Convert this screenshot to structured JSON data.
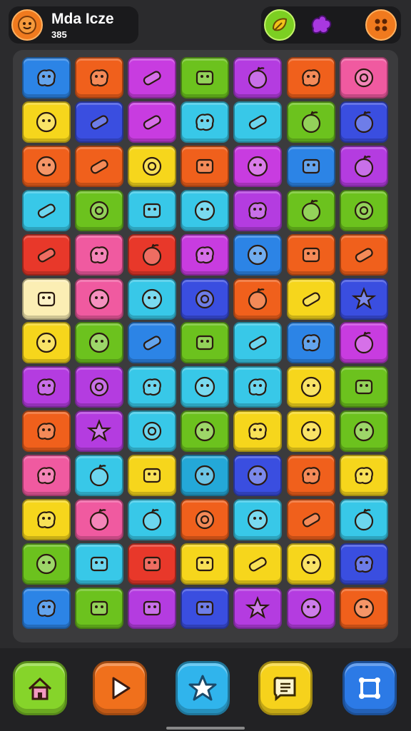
{
  "header": {
    "title": "Mda Icze",
    "score": "385"
  },
  "colors": {
    "blue": "#2c84e6",
    "orange": "#f0601c",
    "purple": "#b43ce0",
    "green": "#6cc21e",
    "cyan": "#38c8e8",
    "pink": "#f05aa0",
    "yellow": "#f6d61c",
    "red": "#e8382a",
    "magenta": "#c83ce0",
    "cream": "#fbeeb4",
    "teal": "#24a8d8",
    "indigo": "#3a4ee0"
  },
  "grid": [
    [
      "blue",
      "orange",
      "magenta",
      "green",
      "purple",
      "orange",
      "pink"
    ],
    [
      "yellow",
      "indigo",
      "magenta",
      "cyan",
      "cyan",
      "green",
      "indigo"
    ],
    [
      "orange",
      "orange",
      "yellow",
      "orange",
      "magenta",
      "blue",
      "purple"
    ],
    [
      "cyan",
      "green",
      "cyan",
      "cyan",
      "purple",
      "green",
      "green"
    ],
    [
      "red",
      "pink",
      "red",
      "magenta",
      "blue",
      "orange",
      "orange"
    ],
    [
      "cream",
      "pink",
      "cyan",
      "indigo",
      "orange",
      "yellow",
      "indigo"
    ],
    [
      "yellow",
      "green",
      "blue",
      "green",
      "cyan",
      "blue",
      "magenta"
    ],
    [
      "purple",
      "purple",
      "cyan",
      "cyan",
      "cyan",
      "yellow",
      "green"
    ],
    [
      "orange",
      "purple",
      "cyan",
      "green",
      "yellow",
      "yellow",
      "green"
    ],
    [
      "pink",
      "cyan",
      "yellow",
      "teal",
      "indigo",
      "orange",
      "yellow"
    ],
    [
      "yellow",
      "pink",
      "cyan",
      "orange",
      "cyan",
      "orange",
      "cyan"
    ],
    [
      "green",
      "cyan",
      "red",
      "yellow",
      "yellow",
      "yellow",
      "indigo"
    ],
    [
      "blue",
      "green",
      "purple",
      "indigo",
      "purple",
      "purple",
      "orange"
    ]
  ],
  "icons": [
    [
      "octopus-icon",
      "bug-icon",
      "candy-icon",
      "robot-icon",
      "apple-icon",
      "crab-icon",
      "donut-icon"
    ],
    [
      "smiley-icon",
      "potion-icon",
      "pencil-icon",
      "fish-icon",
      "carrot-icon",
      "orange-icon",
      "berry-icon"
    ],
    [
      "ghost-icon",
      "carrot-icon",
      "donut-icon",
      "cake-slice-icon",
      "blob-icon",
      "box-icon",
      "icecream-icon"
    ],
    [
      "candy-icon",
      "spiral-icon",
      "toaster-icon",
      "pea-icon",
      "alien-icon",
      "pumpkin-icon",
      "ball-icon"
    ],
    [
      "eggplant-icon",
      "tooth-icon",
      "apple-icon",
      "bird-icon",
      "blob-icon",
      "cheese-icon",
      "crayon-icon"
    ],
    [
      "cookie-icon",
      "smiley-icon",
      "ring-icon",
      "clock-icon",
      "grape-icon",
      "marker-icon",
      "leaf-icon"
    ],
    [
      "blob-icon",
      "blob-icon",
      "spoon-icon",
      "jar-icon",
      "popsicle-icon",
      "flame-icon",
      "strawberry-icon"
    ],
    [
      "crab-icon",
      "donut-icon",
      "bug-icon",
      "egg-icon",
      "mushroom-icon",
      "ghost-icon",
      "gift-icon"
    ],
    [
      "bowl-icon",
      "flower-icon",
      "melon-icon",
      "smiley-icon",
      "dog-icon",
      "ghost-icon",
      "egg-icon"
    ],
    [
      "monster-icon",
      "apple-icon",
      "toast-icon",
      "ring-icon",
      "blob-icon",
      "crab-icon",
      "turtle-icon"
    ],
    [
      "octopus-icon",
      "pear-icon",
      "apple-icon",
      "melon-icon",
      "smiley-icon",
      "chili-icon",
      "strawberry-icon"
    ],
    [
      "ghost-icon",
      "jar-icon",
      "box-icon",
      "cookie-icon",
      "eggplant-icon",
      "balloon-icon",
      "bug-icon"
    ],
    [
      "frog-icon",
      "cactus-icon",
      "basket-icon",
      "hand-icon",
      "star-icon",
      "balloon-icon",
      "smiley-icon"
    ]
  ],
  "nav": [
    {
      "name": "home",
      "color": "#86d42a",
      "icon": "home-icon"
    },
    {
      "name": "play",
      "color": "#f0701c",
      "icon": "play-icon"
    },
    {
      "name": "star",
      "color": "#30b4ec",
      "icon": "star-icon"
    },
    {
      "name": "messages",
      "color": "#f6d21c",
      "icon": "message-icon"
    },
    {
      "name": "settings",
      "color": "#2c7ae6",
      "icon": "frame-icon"
    }
  ]
}
